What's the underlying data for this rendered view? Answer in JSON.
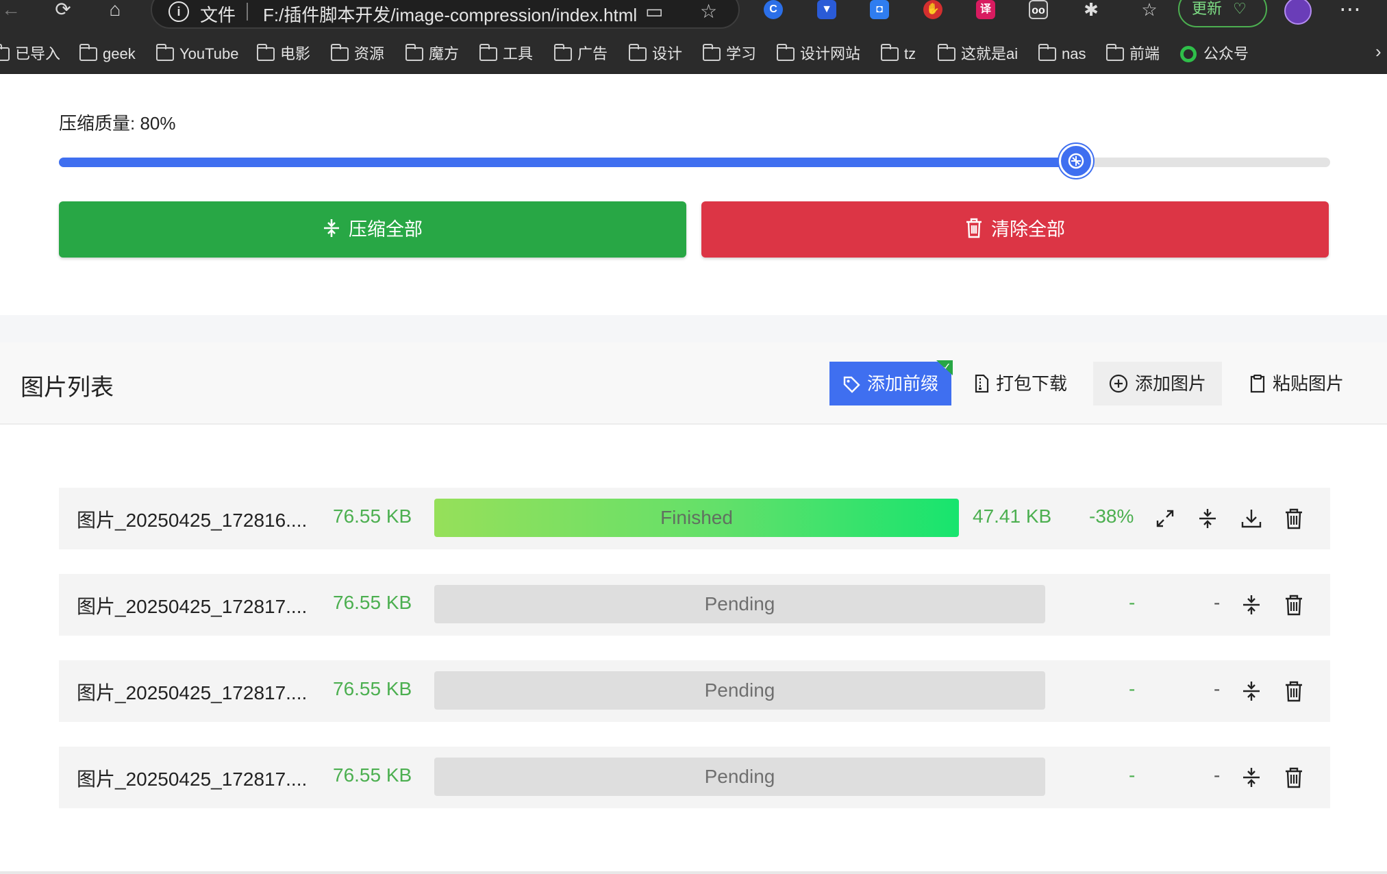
{
  "browser": {
    "address": {
      "file_label": "文件",
      "url": "F:/插件脚本开发/image-compression/index.html"
    },
    "update_label": "更新",
    "bookmarks": [
      "已导入",
      "geek",
      "YouTube",
      "电影",
      "资源",
      "魔方",
      "工具",
      "广告",
      "设计",
      "学习",
      "设计网站",
      "tz",
      "这就是ai",
      "nas",
      "前端",
      "公众号"
    ]
  },
  "settings": {
    "quality_label": "压缩质量: 80%",
    "quality_value": 80,
    "compress_all_label": "压缩全部",
    "clear_all_label": "清除全部"
  },
  "list": {
    "title": "图片列表",
    "add_prefix_label": "添加前缀",
    "pack_download_label": "打包下载",
    "add_image_label": "添加图片",
    "paste_image_label": "粘贴图片",
    "rows": [
      {
        "name": "图片_20250425_172816....",
        "original_size": "76.55 KB",
        "status": "Finished",
        "progress": 1.0,
        "new_size": "47.41 KB",
        "ratio": "-38%"
      },
      {
        "name": "图片_20250425_172817....",
        "original_size": "76.55 KB",
        "status": "Pending",
        "new_size": "-",
        "ratio": "-"
      },
      {
        "name": "图片_20250425_172817....",
        "original_size": "76.55 KB",
        "status": "Pending",
        "new_size": "-",
        "ratio": "-"
      },
      {
        "name": "图片_20250425_172817....",
        "original_size": "76.55 KB",
        "status": "Pending",
        "new_size": "-",
        "ratio": "-"
      }
    ]
  },
  "colors": {
    "primary": "#3f6ff0",
    "success": "#28a745",
    "danger": "#dc3545",
    "size_text": "#4caf50"
  }
}
